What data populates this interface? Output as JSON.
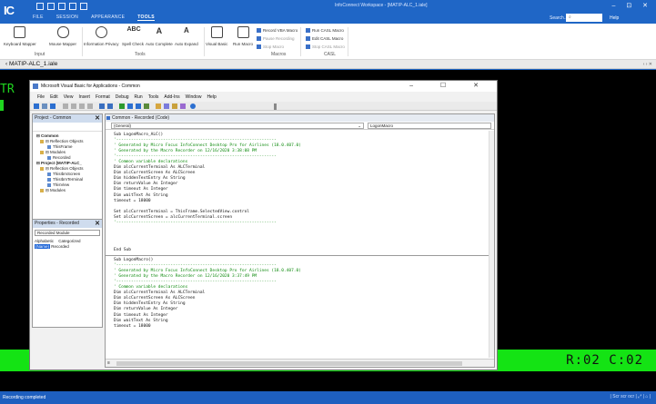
{
  "app": {
    "logo": "IC",
    "title": "InfoConnect Workspace - [MATIP-ALC_1.iale]",
    "window_controls": "– ⊡ ✕"
  },
  "ribbon_tabs": [
    "FILE",
    "SESSION",
    "APPEARANCE",
    "TOOLS"
  ],
  "search": {
    "label": "Search...",
    "placeholder": "",
    "help": "Help"
  },
  "ribbon": {
    "input_group": {
      "label": "Input",
      "buttons": [
        "Keyboard Mapper",
        "Mouse Mapper"
      ]
    },
    "tools_group": {
      "label": "Tools",
      "buttons": [
        "Information Privacy",
        "Spell Check",
        "Auto Complete",
        "Auto Expand"
      ]
    },
    "macros_group": {
      "label": "Macros",
      "buttons": [
        "Visual Basic",
        "Run Macro"
      ],
      "small": [
        "Record VBA Macro",
        "Pause Recording",
        "Stop Macro"
      ]
    },
    "casl_group": {
      "label": "CASL",
      "small": [
        "Run CASL Macro",
        "Edit CASL Macro",
        "Stop CASL Macro"
      ]
    }
  },
  "doc_tab": {
    "label": "MATIP-ALC_1.iale",
    "scroll": "‹ › ✕"
  },
  "terminal": {
    "left_text": "TR",
    "position": "R:02 C:02"
  },
  "statusbar": {
    "left": "Recording completed",
    "right": "| Scr scr ocr | ⤢ | ⌂ |"
  },
  "vba": {
    "title": "Microsoft Visual Basic for Applications - Common",
    "controls": "– ☐ ✕",
    "menu": [
      "File",
      "Edit",
      "View",
      "Insert",
      "Format",
      "Debug",
      "Run",
      "Tools",
      "Add-Ins",
      "Window",
      "Help"
    ],
    "project": {
      "title": "Project - Common",
      "tree": [
        {
          "text": "⊟ Common",
          "cls": "b",
          "indent": 2
        },
        {
          "text": "⊟ Reflection Objects",
          "cls": "fi",
          "indent": 6
        },
        {
          "text": "ThisFrame",
          "cls": "mi",
          "indent": 14
        },
        {
          "text": "⊟ Modules",
          "cls": "fi",
          "indent": 6
        },
        {
          "text": "Recorded",
          "cls": "mi",
          "indent": 14
        },
        {
          "text": "⊟ Project (MATIP-ALC_",
          "cls": "b",
          "indent": 2
        },
        {
          "text": "⊟ Reflection Objects",
          "cls": "fi",
          "indent": 6
        },
        {
          "text": "ThisIbmScreen",
          "cls": "mi",
          "indent": 14
        },
        {
          "text": "ThisIbmTerminal",
          "cls": "mi",
          "indent": 14
        },
        {
          "text": "ThisView",
          "cls": "mi",
          "indent": 14
        },
        {
          "text": "⊟ Modules",
          "cls": "fi",
          "indent": 6
        }
      ]
    },
    "properties": {
      "title": "Properties - Recorded",
      "select": "Recorded Module",
      "tabs": [
        "Alphabetic",
        "Categorized"
      ],
      "row_name": "(Name)",
      "row_value": "Recorded"
    },
    "code": {
      "title": "Common - Recorded (Code)",
      "object_drop": "(General)",
      "proc_drop": "LogonMacro",
      "block1": [
        {
          "t": "Sub LogonMacro_ALC()",
          "c": false
        },
        {
          "t": "'-----------------------------------------------------------------",
          "c": true
        },
        {
          "t": "' Generated by Micro Focus InfoConnect Desktop Pro for Airlines (18.0.407.0)",
          "c": true
        },
        {
          "t": "' Generated by the Macro Recorder on 12/16/2020 3:38:08 PM",
          "c": true
        },
        {
          "t": "'-----------------------------------------------------------------",
          "c": true
        },
        {
          "t": "' Common variable declarations",
          "c": true
        },
        {
          "t": "Dim alcCurrentTerminal As ALCTerminal",
          "c": false
        },
        {
          "t": "Dim alcCurrentScreen As ALCScreen",
          "c": false
        },
        {
          "t": "Dim hiddenTextEntry As String",
          "c": false
        },
        {
          "t": "Dim returnValue As Integer",
          "c": false
        },
        {
          "t": "Dim timeout As Integer",
          "c": false
        },
        {
          "t": "Dim waitText As String",
          "c": false
        },
        {
          "t": "timeout = 18000",
          "c": false
        },
        {
          "t": "",
          "c": false
        },
        {
          "t": "Set alcCurrentTerminal = ThisFrame.SelectedView.control",
          "c": false
        },
        {
          "t": "Set alcCurrentScreen = alcCurrentTerminal.screen",
          "c": false
        },
        {
          "t": "'-----------------------------------------------------------------",
          "c": true
        },
        {
          "t": "",
          "c": false
        },
        {
          "t": "",
          "c": false
        },
        {
          "t": "",
          "c": false
        },
        {
          "t": "",
          "c": false
        },
        {
          "t": "End Sub",
          "c": false
        }
      ],
      "block2": [
        {
          "t": "Sub LogonMacro()",
          "c": false
        },
        {
          "t": "'-----------------------------------------------------------------",
          "c": true
        },
        {
          "t": "' Generated by Micro Focus InfoConnect Desktop Pro for Airlines (18.0.407.0)",
          "c": true
        },
        {
          "t": "' Generated by the Macro Recorder on 12/16/2020 3:37:49 PM",
          "c": true
        },
        {
          "t": "'-----------------------------------------------------------------",
          "c": true
        },
        {
          "t": "' Common variable declarations",
          "c": true
        },
        {
          "t": "Dim alcCurrentTerminal As ALCTerminal",
          "c": false
        },
        {
          "t": "Dim alcCurrentScreen As ALCScreen",
          "c": false
        },
        {
          "t": "Dim hiddenTextEntry As String",
          "c": false
        },
        {
          "t": "Dim returnValue As Integer",
          "c": false
        },
        {
          "t": "Dim timeout As Integer",
          "c": false
        },
        {
          "t": "Dim waitText As String",
          "c": false
        },
        {
          "t": "timeout = 18000",
          "c": false
        }
      ]
    }
  }
}
